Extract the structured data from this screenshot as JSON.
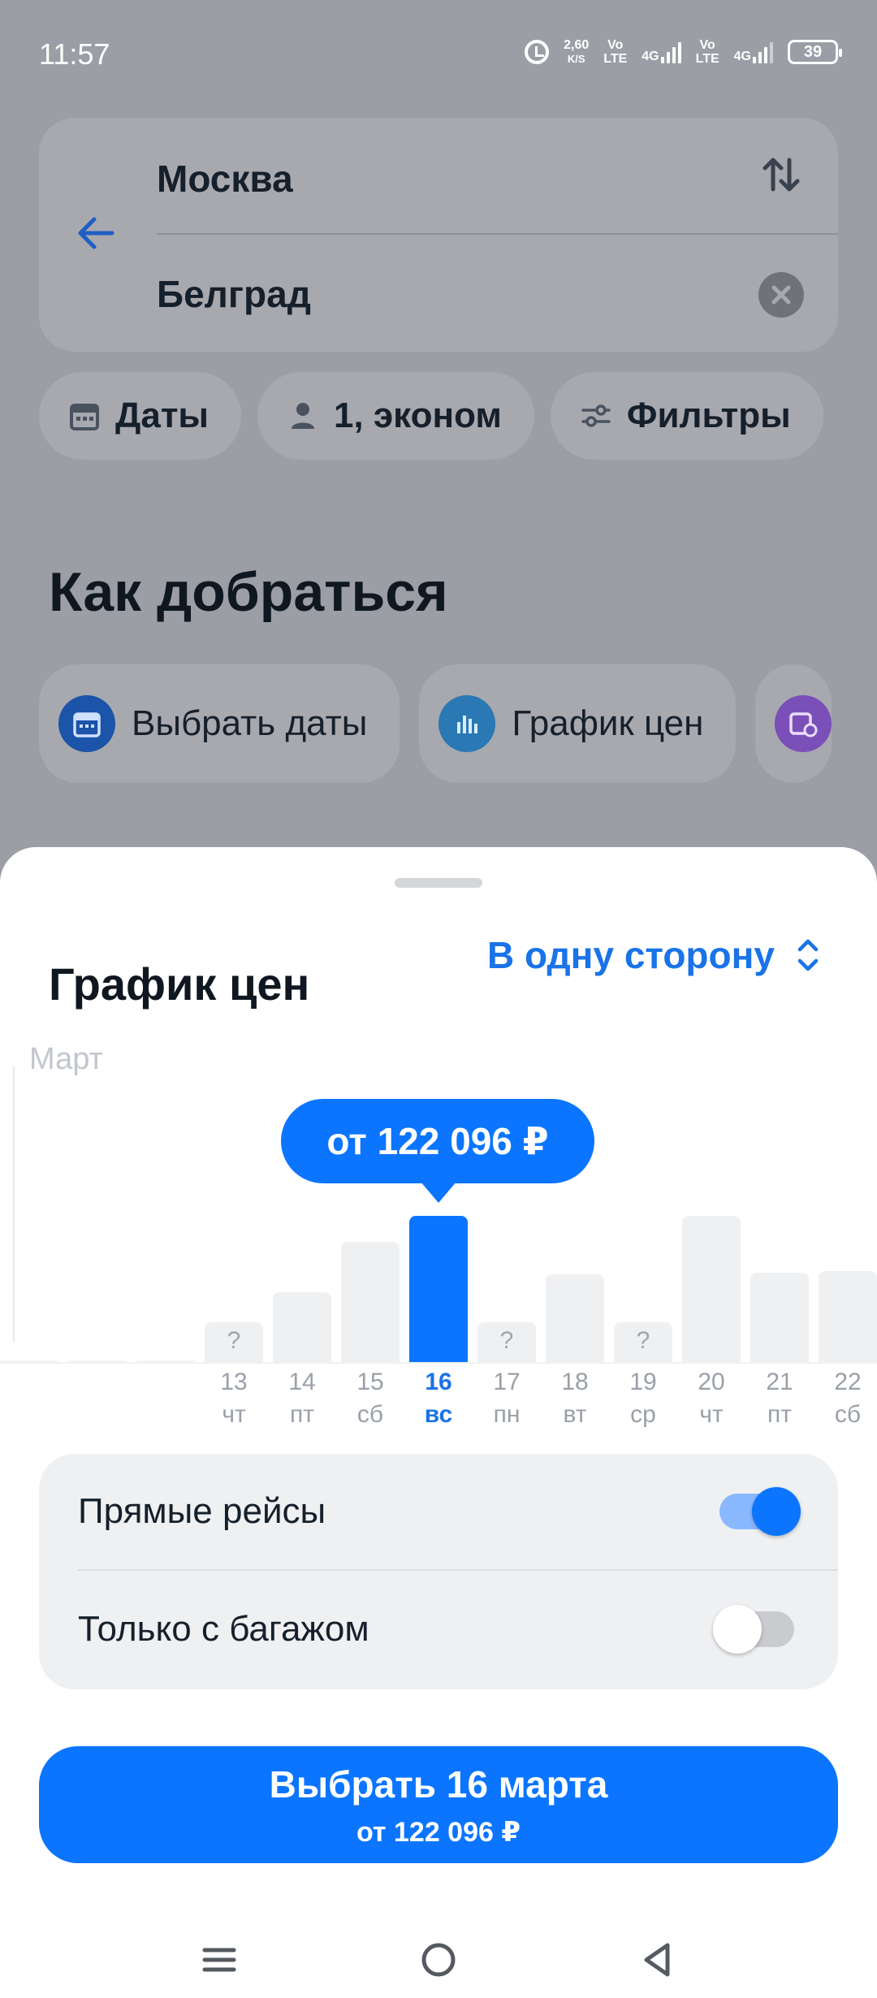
{
  "status": {
    "time": "11:57",
    "speed_value": "2,60",
    "speed_unit": "K/S",
    "sim1_top": "Vo",
    "sim1_bottom": "LTE",
    "net1": "4G",
    "sim2_top": "Vo",
    "sim2_bottom": "LTE",
    "net2": "4G",
    "battery": "39"
  },
  "search": {
    "from": "Москва",
    "to": "Белград"
  },
  "chips": {
    "dates": "Даты",
    "passengers": "1, эконом",
    "filters": "Фильтры"
  },
  "section": {
    "title": "Как добраться"
  },
  "actions": {
    "pick_dates": "Выбрать даты",
    "price_chart": "График цен"
  },
  "sheet": {
    "title": "График цен",
    "mode": "В одну сторону"
  },
  "chart_data": {
    "type": "bar",
    "month": "Март",
    "selected_label": "от 122 096 ₽",
    "selected_index": 3,
    "unknown_marker": "?",
    "categories": [
      {
        "day": "13",
        "weekday": "чт"
      },
      {
        "day": "14",
        "weekday": "пт"
      },
      {
        "day": "15",
        "weekday": "сб"
      },
      {
        "day": "16",
        "weekday": "вс"
      },
      {
        "day": "17",
        "weekday": "пн"
      },
      {
        "day": "18",
        "weekday": "вт"
      },
      {
        "day": "19",
        "weekday": "ср"
      },
      {
        "day": "20",
        "weekday": "чт"
      },
      {
        "day": "21",
        "weekday": "пт"
      },
      {
        "day": "22",
        "weekday": "сб"
      }
    ],
    "relative_values": [
      0.27,
      0.48,
      0.82,
      1.0,
      0.27,
      0.6,
      0.27,
      1.0,
      0.61,
      0.62
    ],
    "unknown": [
      true,
      false,
      false,
      false,
      true,
      false,
      true,
      false,
      false,
      false
    ]
  },
  "options": {
    "direct": "Прямые рейсы",
    "direct_on": true,
    "baggage": "Только с багажом",
    "baggage_on": false
  },
  "cta": {
    "main": "Выбрать 16 марта",
    "sub": "от 122 096 ₽"
  },
  "colors": {
    "accent": "#0b75ff",
    "bar_inactive": "#eff0f2",
    "scrim": "#9b9ea4"
  }
}
